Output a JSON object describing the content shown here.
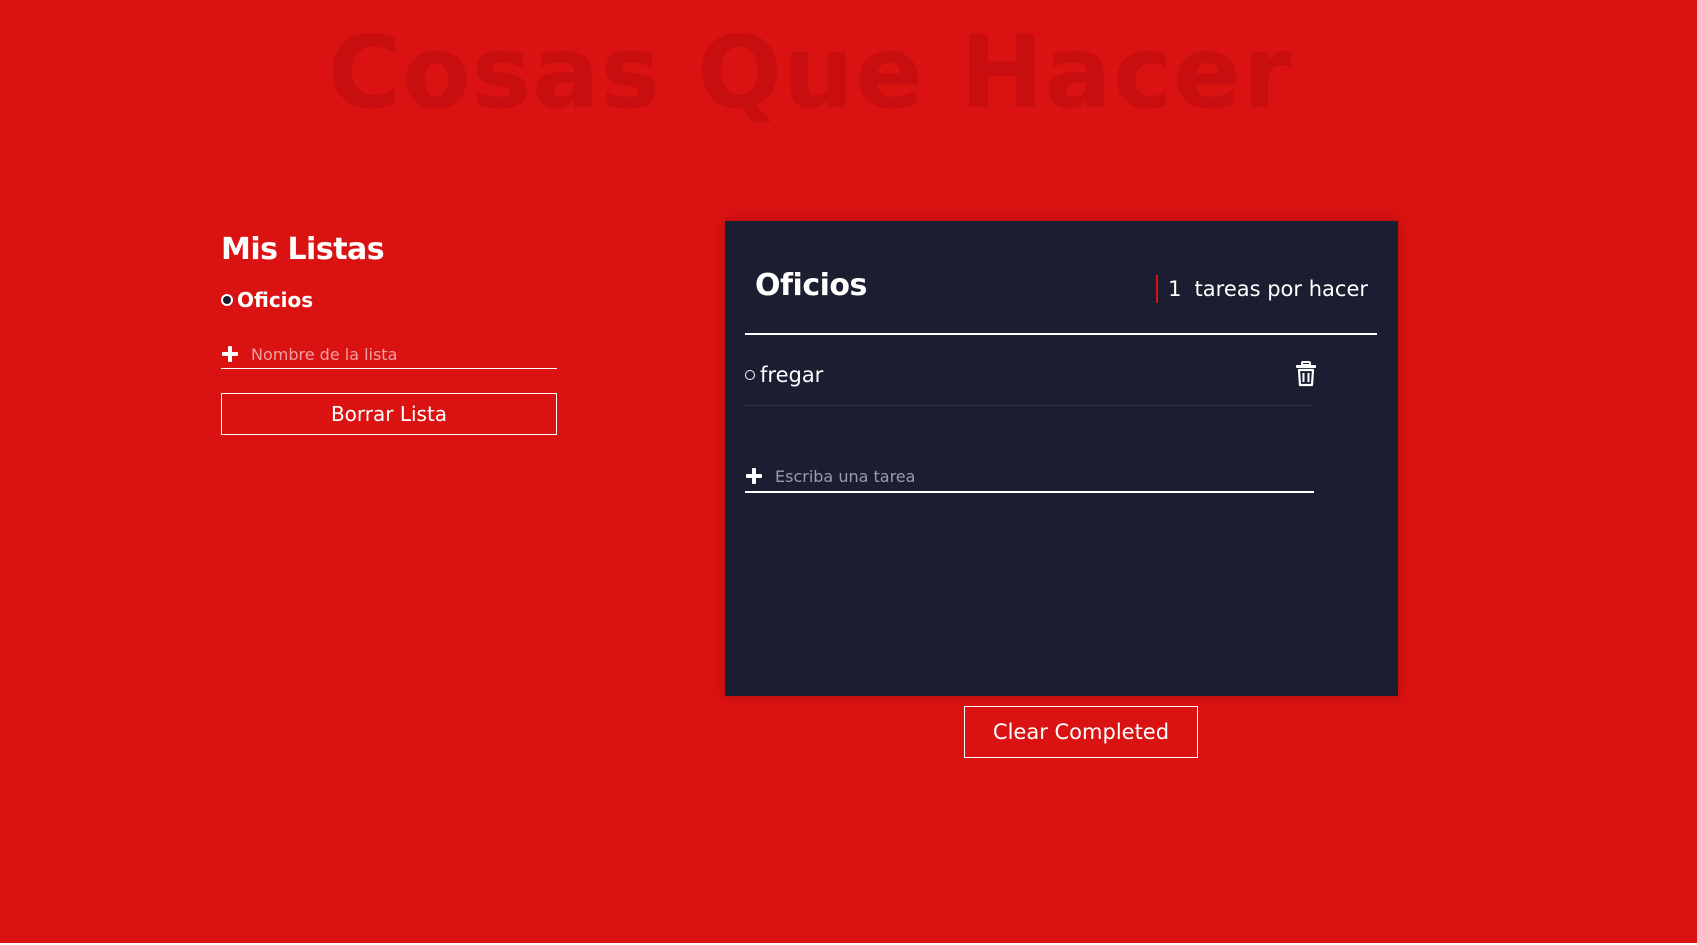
{
  "app": {
    "title": "Cosas Que Hacer"
  },
  "colors": {
    "background": "#da1212",
    "title": "#c80e0e",
    "card": "#1b1d31",
    "text": "#ffffff",
    "accent": "#da1212"
  },
  "sidebar": {
    "heading": "Mis Listas",
    "lists": [
      {
        "name": "Oficios",
        "icon": "bullet-icon"
      }
    ],
    "new_list": {
      "icon": "plus-icon",
      "placeholder": "Nombre de la lista",
      "value": ""
    },
    "delete_button": "Borrar Lista"
  },
  "todo": {
    "title": "Oficios",
    "remaining_count": "1",
    "remaining_label": "tareas por hacer",
    "tasks": [
      {
        "name": "fregar",
        "completed": false,
        "delete_icon": "trash-icon"
      }
    ],
    "new_task": {
      "icon": "plus-icon",
      "placeholder": "Escriba una tarea",
      "value": ""
    }
  },
  "clear_button": "Clear Completed"
}
